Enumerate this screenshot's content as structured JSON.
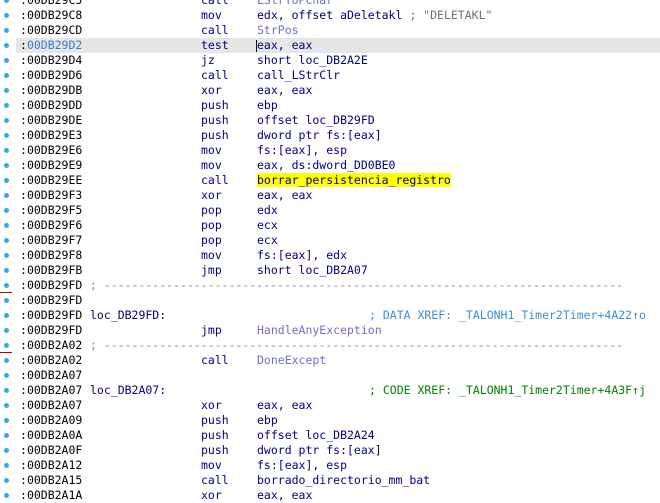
{
  "lines": [
    {
      "addr": "00DB29C5",
      "label": "",
      "mnem": "call",
      "ops": "LStrToPChar",
      "opstyle": "fn",
      "comment": ""
    },
    {
      "addr": "00DB29C8",
      "label": "",
      "mnem": "mov",
      "ops": "edx, offset aDeletakl",
      "opstyle": "",
      "comment": "; \"DELETAKL\""
    },
    {
      "addr": "00DB29CD",
      "label": "",
      "mnem": "call",
      "ops": "StrPos",
      "opstyle": "fn",
      "comment": ""
    },
    {
      "addr": "00DB29D2",
      "label": "",
      "mnem": "test",
      "ops": "eax, eax",
      "opstyle": "",
      "comment": "",
      "selected": true
    },
    {
      "addr": "00DB29D4",
      "label": "",
      "mnem": "jz",
      "ops": "short loc_DB2A2E",
      "opstyle": "",
      "comment": ""
    },
    {
      "addr": "00DB29D6",
      "label": "",
      "mnem": "call",
      "ops": "call_LStrClr",
      "opstyle": "",
      "comment": ""
    },
    {
      "addr": "00DB29DB",
      "label": "",
      "mnem": "xor",
      "ops": "eax, eax",
      "opstyle": "",
      "comment": ""
    },
    {
      "addr": "00DB29DD",
      "label": "",
      "mnem": "push",
      "ops": "ebp",
      "opstyle": "",
      "comment": ""
    },
    {
      "addr": "00DB29DE",
      "label": "",
      "mnem": "push",
      "ops": "offset loc_DB29FD",
      "opstyle": "",
      "comment": ""
    },
    {
      "addr": "00DB29E3",
      "label": "",
      "mnem": "push",
      "ops": "dword ptr fs:[eax]",
      "opstyle": "",
      "comment": ""
    },
    {
      "addr": "00DB29E6",
      "label": "",
      "mnem": "mov",
      "ops": "fs:[eax], esp",
      "opstyle": "",
      "comment": ""
    },
    {
      "addr": "00DB29E9",
      "label": "",
      "mnem": "mov",
      "ops": "eax, ds:dword_DD0BE0",
      "opstyle": "",
      "comment": ""
    },
    {
      "addr": "00DB29EE",
      "label": "",
      "mnem": "call",
      "ops": "borrar_persistencia_registro",
      "opstyle": "hl",
      "comment": ""
    },
    {
      "addr": "00DB29F3",
      "label": "",
      "mnem": "xor",
      "ops": "eax, eax",
      "opstyle": "",
      "comment": ""
    },
    {
      "addr": "00DB29F5",
      "label": "",
      "mnem": "pop",
      "ops": "edx",
      "opstyle": "",
      "comment": ""
    },
    {
      "addr": "00DB29F6",
      "label": "",
      "mnem": "pop",
      "ops": "ecx",
      "opstyle": "",
      "comment": ""
    },
    {
      "addr": "00DB29F7",
      "label": "",
      "mnem": "pop",
      "ops": "ecx",
      "opstyle": "",
      "comment": ""
    },
    {
      "addr": "00DB29F8",
      "label": "",
      "mnem": "mov",
      "ops": "fs:[eax], edx",
      "opstyle": "",
      "comment": ""
    },
    {
      "addr": "00DB29FB",
      "label": "",
      "mnem": "jmp",
      "ops": "short loc_DB2A07",
      "opstyle": "",
      "comment": ""
    },
    {
      "addr": "00DB29FD",
      "sep": "; ---------------------------------------------------------------------------"
    },
    {
      "addr": "00DB29FD",
      "label": "",
      "mnem": "",
      "ops": "",
      "opstyle": "",
      "comment": ""
    },
    {
      "addr": "00DB29FD",
      "label": "loc_DB29FD:",
      "mnem": "",
      "ops": "",
      "opstyle": "",
      "comment": "",
      "xref": "; DATA XREF: _TALONH1_Timer2Timer+4A22↑o",
      "xrefstyle": "data"
    },
    {
      "addr": "00DB29FD",
      "label": "",
      "mnem": "jmp",
      "ops": "HandleAnyException",
      "opstyle": "fn",
      "comment": ""
    },
    {
      "addr": "00DB2A02",
      "sep": "; ---------------------------------------------------------------------------"
    },
    {
      "addr": "00DB2A02",
      "label": "",
      "mnem": "call",
      "ops": "DoneExcept",
      "opstyle": "fn",
      "comment": ""
    },
    {
      "addr": "00DB2A07",
      "label": "",
      "mnem": "",
      "ops": "",
      "opstyle": "",
      "comment": ""
    },
    {
      "addr": "00DB2A07",
      "label": "loc_DB2A07:",
      "mnem": "",
      "ops": "",
      "opstyle": "",
      "comment": "",
      "xref": "; CODE XREF: _TALONH1_Timer2Timer+4A3F↑j",
      "xrefstyle": "code"
    },
    {
      "addr": "00DB2A07",
      "label": "",
      "mnem": "xor",
      "ops": "eax, eax",
      "opstyle": "",
      "comment": ""
    },
    {
      "addr": "00DB2A09",
      "label": "",
      "mnem": "push",
      "ops": "ebp",
      "opstyle": "",
      "comment": ""
    },
    {
      "addr": "00DB2A0A",
      "label": "",
      "mnem": "push",
      "ops": "offset loc_DB2A24",
      "opstyle": "",
      "comment": ""
    },
    {
      "addr": "00DB2A0F",
      "label": "",
      "mnem": "push",
      "ops": "dword ptr fs:[eax]",
      "opstyle": "",
      "comment": ""
    },
    {
      "addr": "00DB2A12",
      "label": "",
      "mnem": "mov",
      "ops": "fs:[eax], esp",
      "opstyle": "",
      "comment": ""
    },
    {
      "addr": "00DB2A15",
      "label": "",
      "mnem": "call",
      "ops": "borrado_directorio_mm_bat",
      "opstyle": "",
      "comment": ""
    },
    {
      "addr": "00DB2A1A",
      "label": "",
      "mnem": "xor",
      "ops": "eax, eax",
      "opstyle": "",
      "comment": ""
    }
  ],
  "segment_prefix": ":",
  "colors": {
    "highlight": "#ffff00",
    "selected_row": "#e6e6e6",
    "gutter_dot": "#3aa6e8",
    "xref_green": "#008000",
    "xref_data": "#3a8fd0"
  }
}
